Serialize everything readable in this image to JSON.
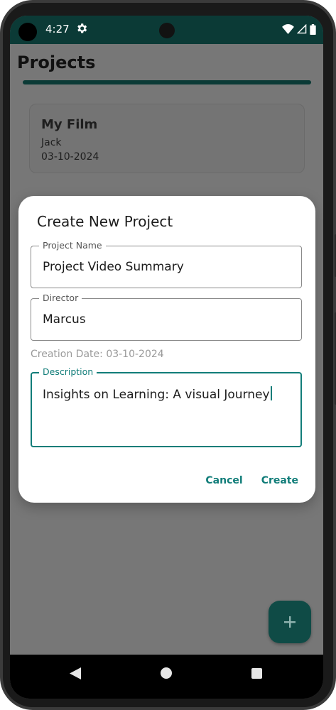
{
  "status_bar": {
    "time": "4:27",
    "icons": [
      "gear-icon",
      "wifi-icon",
      "cell-signal-icon",
      "battery-icon"
    ]
  },
  "app": {
    "title": "Projects",
    "accent_color": "#0b3a36"
  },
  "projects": [
    {
      "title": "My Film",
      "director": "Jack",
      "date": "03-10-2024"
    }
  ],
  "dialog": {
    "title": "Create New Project",
    "project_name": {
      "label": "Project Name",
      "value": "Project Video Summary"
    },
    "director": {
      "label": "Director",
      "value": "Marcus"
    },
    "creation_date": "Creation Date: 03-10-2024",
    "description": {
      "label": "Description",
      "value": "Insights on Learning: A visual Journey"
    },
    "cancel_label": "Cancel",
    "create_label": "Create",
    "accent_color": "#117d79"
  },
  "fab": {
    "icon": "plus-icon",
    "label": "+"
  },
  "nav_bar": {
    "icons": [
      "back-icon",
      "home-icon",
      "recents-icon"
    ]
  }
}
